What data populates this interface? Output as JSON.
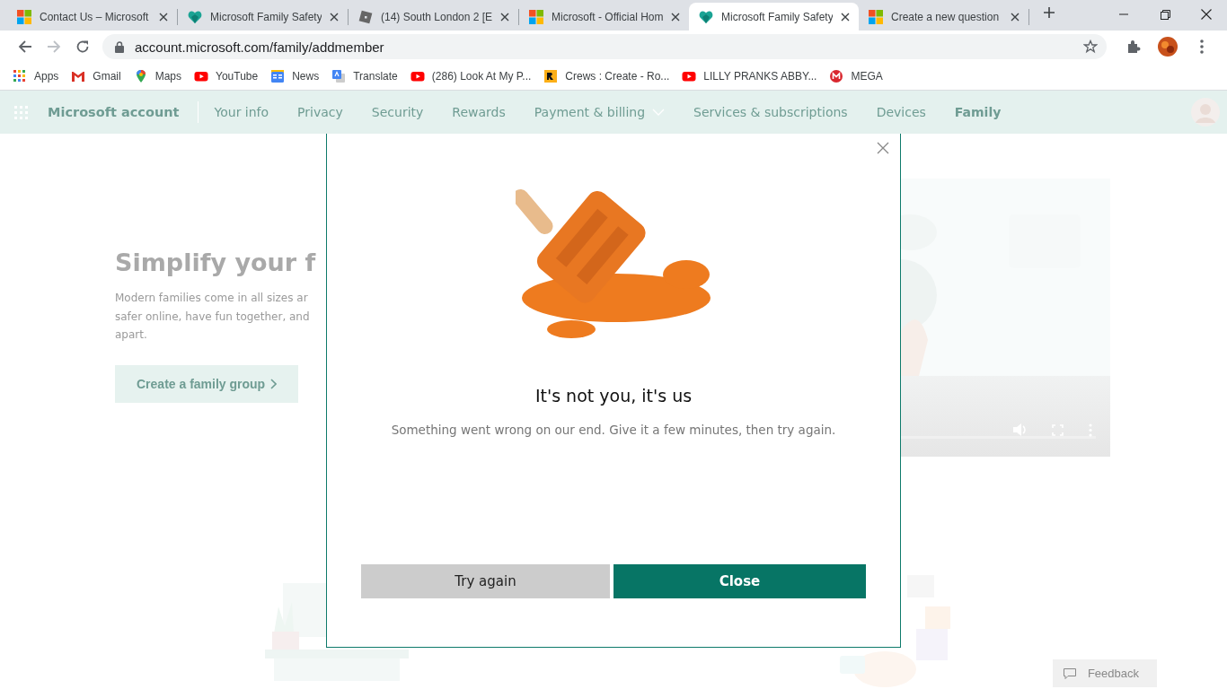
{
  "browser": {
    "tabs": [
      {
        "title": "Contact Us – Microsoft",
        "kind": "microsoft",
        "selected": false
      },
      {
        "title": "Microsoft Family Safety",
        "kind": "heart",
        "selected": false
      },
      {
        "title": "(14) South London 2 [E",
        "kind": "roblox",
        "selected": false
      },
      {
        "title": "Microsoft - Official Hom",
        "kind": "microsoft",
        "selected": false
      },
      {
        "title": "Microsoft Family Safety",
        "kind": "heart",
        "selected": true
      },
      {
        "title": "Create a new question",
        "kind": "microsoft",
        "selected": false
      }
    ],
    "address": "account.microsoft.com/family/addmember",
    "bookmarks": [
      {
        "label": "Apps",
        "kind": "apps"
      },
      {
        "label": "Gmail",
        "kind": "gmail"
      },
      {
        "label": "Maps",
        "kind": "maps"
      },
      {
        "label": "YouTube",
        "kind": "youtube"
      },
      {
        "label": "News",
        "kind": "news"
      },
      {
        "label": "Translate",
        "kind": "translate"
      },
      {
        "label": "(286) Look At My P...",
        "kind": "youtube"
      },
      {
        "label": "Crews : Create - Ro...",
        "kind": "crews"
      },
      {
        "label": "LILLY PRANKS ABBY...",
        "kind": "youtube"
      },
      {
        "label": "MEGA",
        "kind": "mega"
      }
    ]
  },
  "nav": {
    "brand": "Microsoft account",
    "items": [
      {
        "label": "Your info",
        "selected": false,
        "dropdown": false
      },
      {
        "label": "Privacy",
        "selected": false,
        "dropdown": false
      },
      {
        "label": "Security",
        "selected": false,
        "dropdown": false
      },
      {
        "label": "Rewards",
        "selected": false,
        "dropdown": false
      },
      {
        "label": "Payment & billing",
        "selected": false,
        "dropdown": true
      },
      {
        "label": "Services & subscriptions",
        "selected": false,
        "dropdown": false
      },
      {
        "label": "Devices",
        "selected": false,
        "dropdown": false
      },
      {
        "label": "Family",
        "selected": true,
        "dropdown": false
      }
    ]
  },
  "hero": {
    "heading": "Simplify your f",
    "lines": [
      "Modern families come in all sizes ar",
      "safer online, have fun together, and",
      "apart."
    ],
    "button": "Create a family group"
  },
  "dialog": {
    "title": "It's not you, it's us",
    "message": "Something went wrong on our end. Give it a few minutes, then try again.",
    "buttons": [
      {
        "label": "Try again",
        "kind": "secondary"
      },
      {
        "label": "Close",
        "kind": "primary"
      }
    ]
  },
  "feedback": "Feedback"
}
